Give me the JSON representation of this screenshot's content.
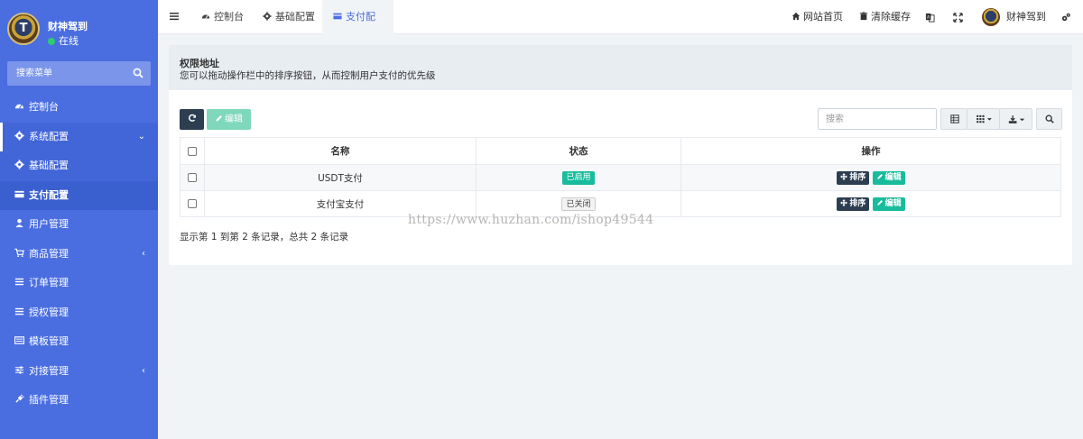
{
  "sidebar": {
    "user": {
      "name": "财神驾到",
      "status": "在线",
      "avatar_letter": "T"
    },
    "search": {
      "placeholder": "搜索菜单"
    },
    "items": [
      {
        "label": "控制台",
        "icon": "dashboard-icon"
      },
      {
        "label": "系统配置",
        "icon": "gear-icon",
        "expanded": true
      },
      {
        "label": "基础配置",
        "icon": "gear-icon"
      },
      {
        "label": "支付配置",
        "icon": "credit-card-icon",
        "active": true
      },
      {
        "label": "用户管理",
        "icon": "user-icon"
      },
      {
        "label": "商品管理",
        "icon": "cart-icon"
      },
      {
        "label": "订单管理",
        "icon": "list-icon"
      },
      {
        "label": "授权管理",
        "icon": "list-icon"
      },
      {
        "label": "模板管理",
        "icon": "template-icon"
      },
      {
        "label": "对接管理",
        "icon": "sliders-icon"
      },
      {
        "label": "插件管理",
        "icon": "plug-icon"
      }
    ]
  },
  "navbar": {
    "tabs": [
      {
        "label": "控制台"
      },
      {
        "label": "基础配置"
      },
      {
        "label": "支付配置",
        "active": true
      }
    ],
    "right": {
      "home": "网站首页",
      "clear_cache": "清除缓存",
      "user": "财神驾到"
    }
  },
  "panel": {
    "title": "权限地址",
    "description": "您可以拖动操作栏中的排序按钮，从而控制用户支付的优先级"
  },
  "toolbar": {
    "edit_label": "编辑",
    "search_placeholder": "搜索"
  },
  "table": {
    "headers": [
      "名称",
      "状态",
      "操作"
    ],
    "rows": [
      {
        "name": "USDT支付",
        "status": "已启用",
        "sort": "排序",
        "edit": "编辑"
      },
      {
        "name": "支付宝支付",
        "status": "已关闭",
        "sort": "排序",
        "edit": "编辑"
      }
    ]
  },
  "pager": {
    "text": "显示第 1 到第 2 条记录，总共 2 条记录"
  },
  "watermark": "https://www.huzhan.com/ishop49544",
  "colors": {
    "sidebar": "#4a6ee0",
    "accent": "#4a6ee0",
    "success": "#18bc9c",
    "dark": "#2c3e50"
  }
}
